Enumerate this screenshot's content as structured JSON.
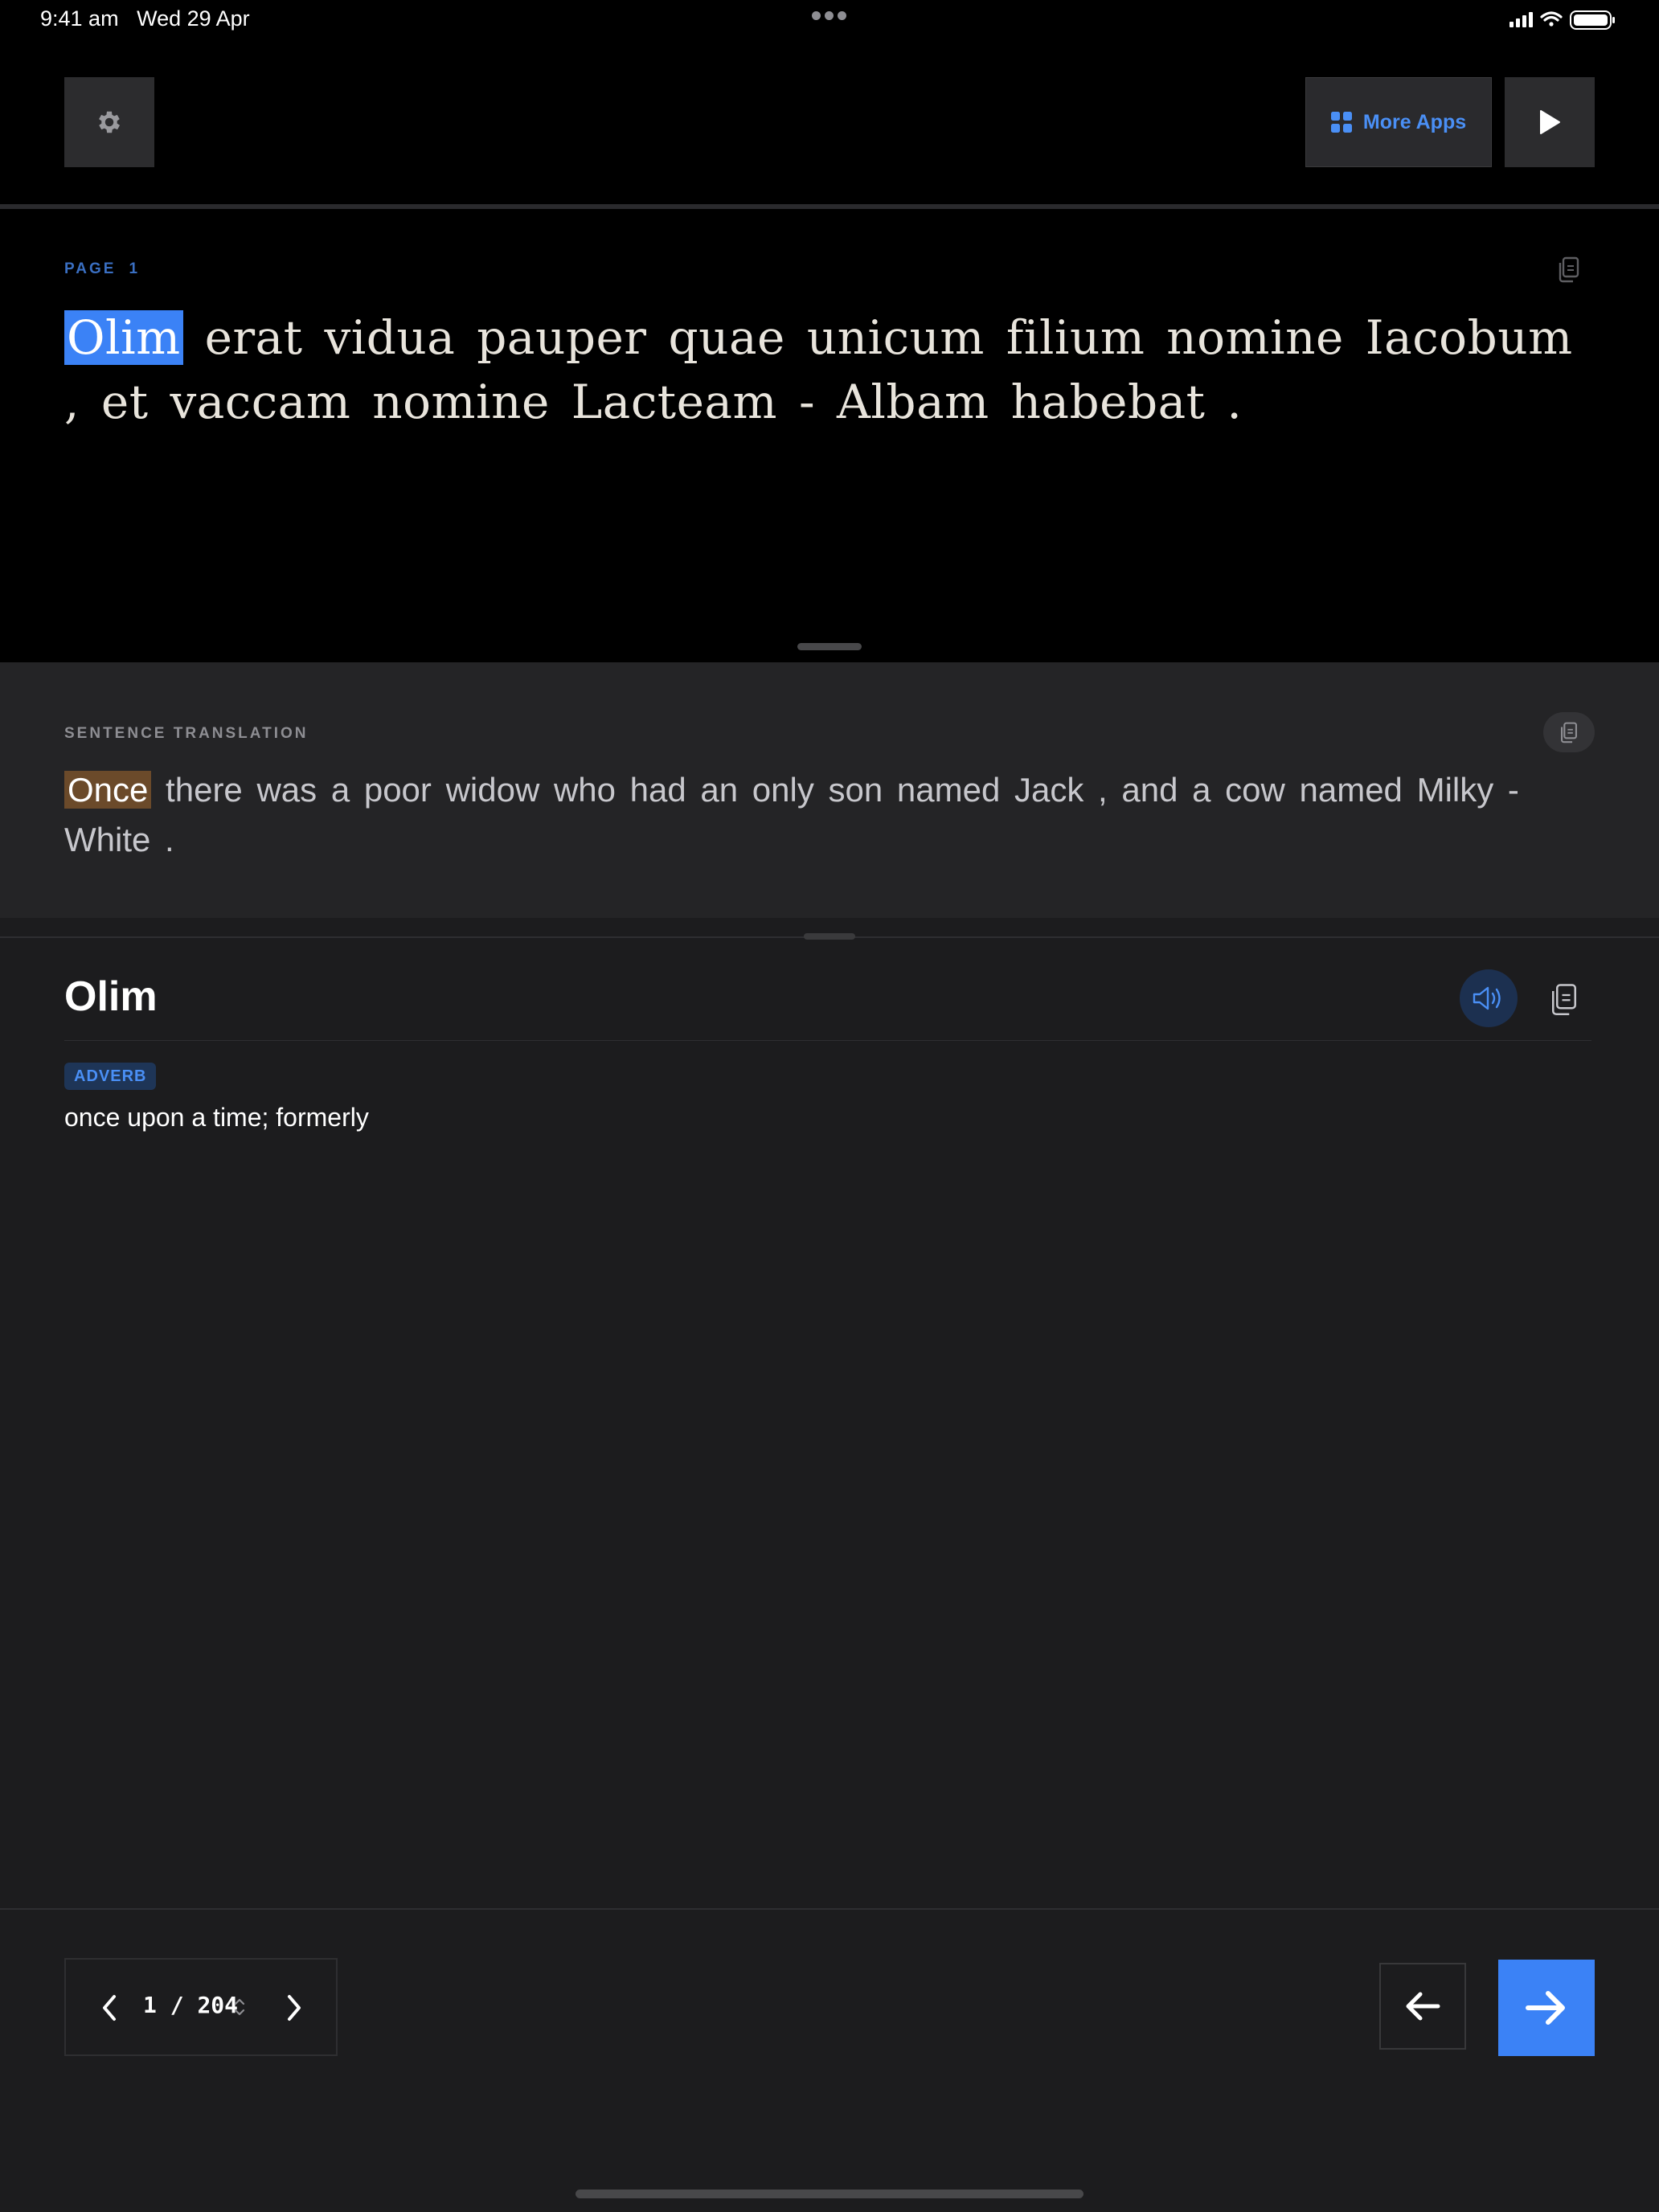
{
  "status_bar": {
    "time": "9:41 am",
    "date": "Wed 29 Apr",
    "icons": [
      "signal-icon",
      "wifi-icon",
      "battery-icon"
    ]
  },
  "header": {
    "settings_icon": "gear-icon",
    "more_apps_label": "More Apps",
    "more_apps_icon": "grid-icon",
    "play_icon": "play-icon"
  },
  "page": {
    "label": "PAGE",
    "number": "1",
    "copy_icon": "copy-icon",
    "words": [
      {
        "text": "Olim",
        "highlighted": true
      },
      {
        "text": "erat"
      },
      {
        "text": "vidua"
      },
      {
        "text": "pauper"
      },
      {
        "text": "quae"
      },
      {
        "text": "unicum"
      },
      {
        "text": "filium"
      },
      {
        "text": "nomine"
      },
      {
        "text": "Iacobum"
      },
      {
        "text": ","
      },
      {
        "text": "et"
      },
      {
        "text": "vaccam"
      },
      {
        "text": "nomine"
      },
      {
        "text": "Lacteam"
      },
      {
        "text": "-"
      },
      {
        "text": "Albam"
      },
      {
        "text": "habebat"
      },
      {
        "text": "."
      }
    ]
  },
  "translation": {
    "label": "SENTENCE TRANSLATION",
    "copy_icon": "copy-icon",
    "highlighted": "Once",
    "rest": " there was a poor widow who had an only son named Jack , and a cow named Milky - White ."
  },
  "dictionary": {
    "word": "Olim",
    "speaker_icon": "speaker-icon",
    "copy_icon": "copy-icon",
    "part_of_speech": "ADVERB",
    "definition": "once upon a time; formerly"
  },
  "footer": {
    "page_current": "1",
    "page_separator": "/",
    "page_total": "204",
    "back_icon": "arrow-left-icon",
    "forward_icon": "arrow-right-icon"
  },
  "colors": {
    "accent": "#3b82f6",
    "accent_text": "#4a8ff5",
    "translation_highlight": "#6b4a2a",
    "background_top": "#000000",
    "background_panel": "#242426",
    "background_main": "#1c1c1e"
  }
}
